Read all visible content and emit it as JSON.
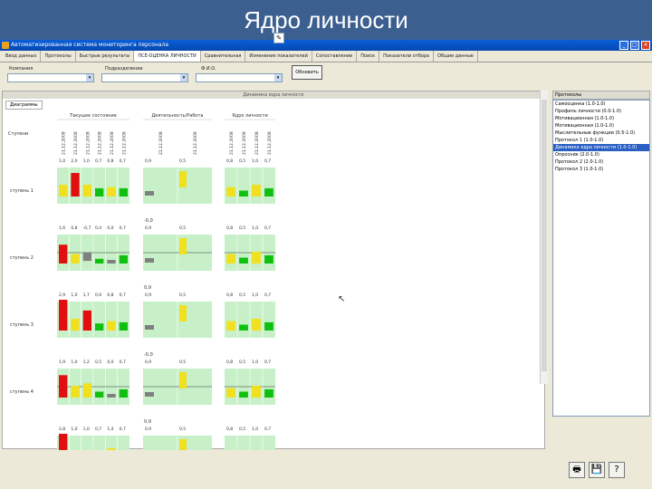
{
  "slide": {
    "title": "Ядро личности"
  },
  "window": {
    "title": "Автоматизированная система мониторинга персонала",
    "buttons": {
      "minimize": "_",
      "maximize": "□",
      "close": "×"
    }
  },
  "tabs": [
    {
      "label": "Ввод данных",
      "active": false
    },
    {
      "label": "Протоколы",
      "active": false
    },
    {
      "label": "Быстрые результаты",
      "active": false
    },
    {
      "label": "ПСЕ-ОЦЕНКА ЛИЧНОСТИ",
      "active": true
    },
    {
      "label": "Сравнительная",
      "active": false
    },
    {
      "label": "Изменение показателей",
      "active": false
    },
    {
      "label": "Сопоставление",
      "active": false
    },
    {
      "label": "Поиск",
      "active": false
    },
    {
      "label": "Показатели отбора",
      "active": false
    },
    {
      "label": "Общие данные",
      "active": false
    }
  ],
  "filters": {
    "company_label": "Компания",
    "department_label": "Подразделение",
    "fio_label": "Ф.И.О.",
    "show_button": "Обновить"
  },
  "panel": {
    "header": "Динамика ядра личности",
    "tab": "Диаграммы",
    "row_header": "Ступени",
    "group_titles": [
      "Текущее состояние",
      "Деятельность/Работа",
      "Ядро личности"
    ],
    "dates": {
      "g1": [
        "21.12.2008",
        "21.12.2008",
        "21.12.2008",
        "21.12.2008",
        "21.12.2008",
        "21.12.2008"
      ],
      "g2": [
        "21.12.2008",
        "21.12.2008"
      ],
      "g3": [
        "21.12.2008",
        "21.12.2008",
        "21.12.2008",
        "21.12.2008"
      ]
    }
  },
  "chart_data": {
    "type": "bar",
    "rows": [
      {
        "label": "ступень 1",
        "above": "",
        "g1": [
          1.0,
          2.0,
          1.0,
          0.7,
          0.8,
          0.7
        ],
        "g2": [
          0.9,
          0.5
        ],
        "g3": [
          0.8,
          0.5,
          1.0,
          0.7
        ]
      },
      {
        "label": "ступень 2",
        "above": "-0,0",
        "g1": [
          1.6,
          0.8,
          -0.7,
          0.4,
          0.0,
          0.7
        ],
        "g2": [
          0.9,
          0.5
        ],
        "g3": [
          0.8,
          0.5,
          1.0,
          0.7
        ]
      },
      {
        "label": "ступень 3",
        "above": "0,9",
        "g1": [
          2.9,
          1.0,
          1.7,
          0.6,
          0.8,
          0.7
        ],
        "g2": [
          0.9,
          0.5
        ],
        "g3": [
          0.8,
          0.5,
          1.0,
          0.7
        ]
      },
      {
        "label": "ступень 4",
        "above": "-0,0",
        "g1": [
          1.9,
          1.0,
          1.2,
          0.5,
          0.0,
          0.7
        ],
        "g2": [
          0.9,
          0.5
        ],
        "g3": [
          0.8,
          0.5,
          1.0,
          0.7
        ]
      },
      {
        "label": "ступень 5",
        "above": "0,9",
        "g1": [
          2.8,
          1.0,
          1.0,
          0.7,
          1.4,
          0.7
        ],
        "g2": [
          0.9,
          0.5
        ],
        "g3": [
          0.8,
          0.5,
          1.0,
          0.7
        ]
      }
    ],
    "display_values": {
      "ступень 1": {
        "g1": [
          "1,0",
          "2,0",
          "1,0",
          "0,7",
          "0,8",
          "0,7"
        ],
        "g2": [
          "0,9",
          "0,5"
        ],
        "g3": [
          "0,8",
          "0,5",
          "1,0",
          "0,7"
        ]
      },
      "ступень 2": {
        "g1": [
          "1,6",
          "0,8",
          "-0,7",
          "0,4",
          "0,0",
          "0,7"
        ],
        "g2": [
          "0,9",
          "0,5"
        ],
        "g3": [
          "0,8",
          "0,5",
          "1,0",
          "0,7"
        ]
      },
      "ступень 3": {
        "g1": [
          "2,9",
          "1,0",
          "1,7",
          "0,6",
          "0,8",
          "0,7"
        ],
        "g2": [
          "0,9",
          "0,5"
        ],
        "g3": [
          "0,8",
          "0,5",
          "1,0",
          "0,7"
        ]
      },
      "ступень 4": {
        "g1": [
          "1,9",
          "1,0",
          "1,2",
          "0,5",
          "0,0",
          "0,7"
        ],
        "g2": [
          "0,9",
          "0,5"
        ],
        "g3": [
          "0,8",
          "0,5",
          "1,0",
          "0,7"
        ]
      },
      "ступень 5": {
        "g1": [
          "2,8",
          "1,0",
          "1,0",
          "0,7",
          "1,4",
          "0,7"
        ],
        "g2": [
          "0,9",
          "0,5"
        ],
        "g3": [
          "0,8",
          "0,5",
          "1,0",
          "0,7"
        ]
      }
    },
    "colors": {
      "red": "#e01010",
      "green": "#10c010",
      "yellow": "#f0e020",
      "gray": "#808080",
      "cell_bg": "#c8f0c8"
    }
  },
  "right_panel": {
    "title": "Протоколы",
    "items": [
      {
        "label": "Самооценка (1.0-1.0)",
        "selected": false
      },
      {
        "label": "Профиль личности (0.0-1.0)",
        "selected": false
      },
      {
        "label": "Мотивационная (1.0-1.0)",
        "selected": false
      },
      {
        "label": "Мотивационная (1.0-1.0)",
        "selected": false
      },
      {
        "label": "Мыслительные функции (0.5-1.0)",
        "selected": false
      },
      {
        "label": "Протокол 1 (1.0-1.0)",
        "selected": false
      },
      {
        "label": "Динамика ядра личности (1.0-1.0)",
        "selected": true
      },
      {
        "label": "Опросник (2.0-1.0)",
        "selected": false
      },
      {
        "label": "Протокол 2 (2.0-1.0)",
        "selected": false
      },
      {
        "label": "Протокол 3 (1.0-1.0)",
        "selected": false
      }
    ]
  },
  "bottom_buttons": {
    "print": "🖶",
    "save": "💾",
    "help": "?"
  }
}
